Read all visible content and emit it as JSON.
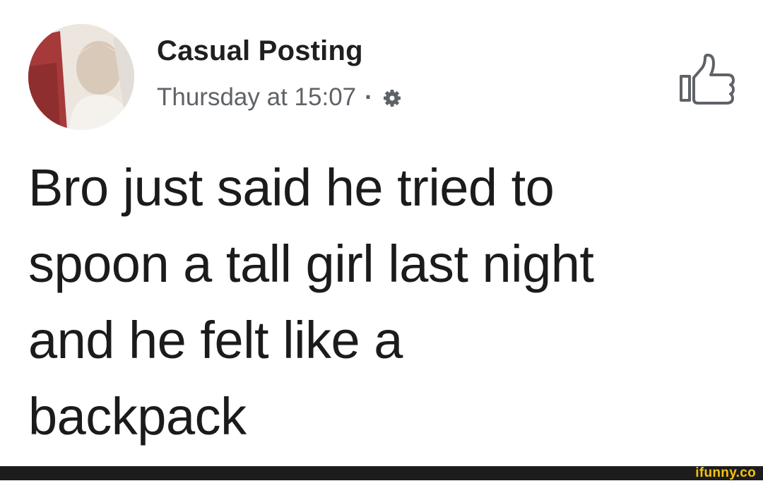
{
  "post": {
    "author": "Casual Posting",
    "timestamp": "Thursday at 15:07",
    "separator": "·",
    "privacy_icon": "gear-icon",
    "like_icon": "thumbs-up-icon",
    "text_lines": [
      "Bro just said he tried to",
      "spoon a tall girl last night",
      "and he felt like a",
      "backpack"
    ]
  },
  "watermark": {
    "text": "ifunny.co",
    "color": "#f4c20d"
  },
  "colors": {
    "background": "#ffffff",
    "text": "#1b1b1b",
    "meta_text": "#5f6368",
    "footer_bar": "#1c1c1c"
  }
}
